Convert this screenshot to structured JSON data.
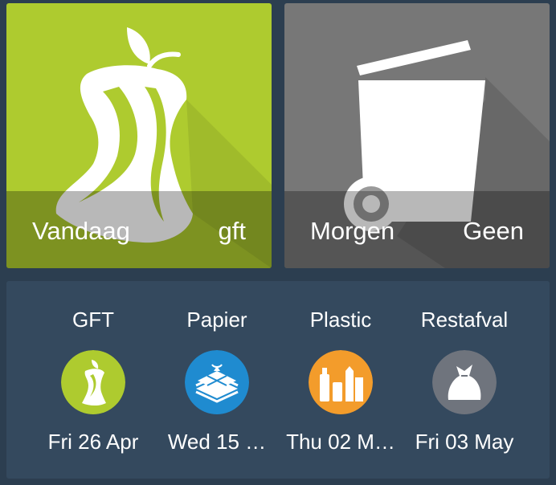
{
  "tiles": {
    "today": {
      "day": "Vandaag",
      "type": "gft",
      "color": "#aecb2f",
      "icon": "apple-core-icon"
    },
    "tomorrow": {
      "day": "Morgen",
      "type": "Geen",
      "color": "#777777",
      "icon": "trash-bin-icon"
    }
  },
  "schedule": {
    "items": [
      {
        "name": "GFT",
        "date": "Fri 26 Apr",
        "icon": "apple-core-icon",
        "color": "#aecb2f"
      },
      {
        "name": "Papier",
        "date": "Wed 15 …",
        "icon": "paper-stack-icon",
        "color": "#1f8bd0"
      },
      {
        "name": "Plastic",
        "date": "Thu 02 M…",
        "icon": "plastic-bottles-icon",
        "color": "#f39c2b"
      },
      {
        "name": "Restafval",
        "date": "Fri 03 May",
        "icon": "garbage-bag-icon",
        "color": "#6f747d"
      }
    ]
  }
}
